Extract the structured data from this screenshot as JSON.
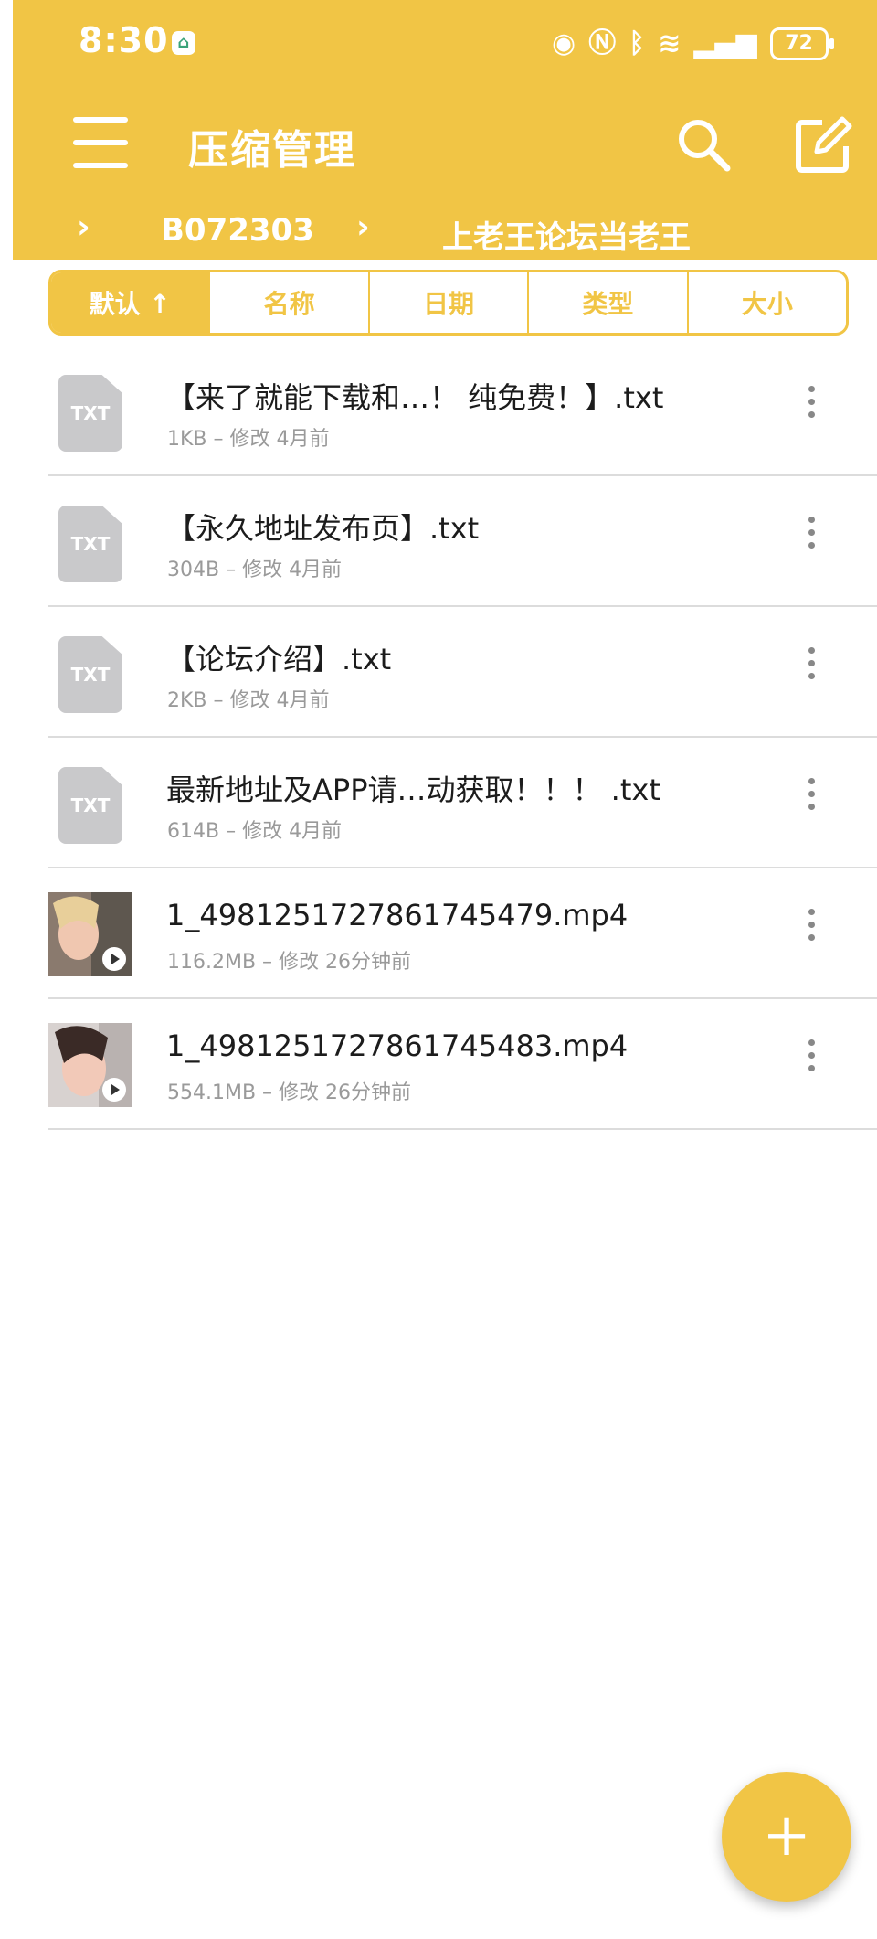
{
  "status_bar": {
    "time": "8:30",
    "battery": "72",
    "icons": [
      "home-app-icon",
      "eye-icon",
      "nfc-icon",
      "bluetooth-icon",
      "wifi-icon",
      "4g-signal-icon",
      "battery-icon"
    ]
  },
  "app_bar": {
    "title": "压缩管理",
    "menu_icon": "hamburger-menu-icon",
    "search_icon": "search-icon",
    "edit_icon": "edit-icon"
  },
  "breadcrumb": [
    "B072303",
    "上老王论坛当老王"
  ],
  "sort_tabs": [
    {
      "label": "默认 ↑",
      "active": true
    },
    {
      "label": "名称",
      "active": false
    },
    {
      "label": "日期",
      "active": false
    },
    {
      "label": "类型",
      "active": false
    },
    {
      "label": "大小",
      "active": false
    }
  ],
  "files": [
    {
      "name": "【来了就能下载和…！ 纯免费！】.txt",
      "meta": "1KB – 修改 4月前",
      "type": "txt"
    },
    {
      "name": "【永久地址发布页】.txt",
      "meta": "304B – 修改 4月前",
      "type": "txt"
    },
    {
      "name": "【论坛介绍】.txt",
      "meta": "2KB – 修改 4月前",
      "type": "txt"
    },
    {
      "name": "最新地址及APP请…动获取！！！ .txt",
      "meta": "614B – 修改 4月前",
      "type": "txt"
    },
    {
      "name": "1_4981251727861745479.mp4",
      "meta": "116.2MB – 修改 26分钟前",
      "type": "video"
    },
    {
      "name": "1_4981251727861745483.mp4",
      "meta": "554.1MB – 修改 26分钟前",
      "type": "video"
    }
  ],
  "file_icon_label": "TXT",
  "fab_label": "+",
  "colors": {
    "accent": "#f1c545",
    "divider": "#dcdcdc",
    "meta_text": "#9a9a9a"
  }
}
